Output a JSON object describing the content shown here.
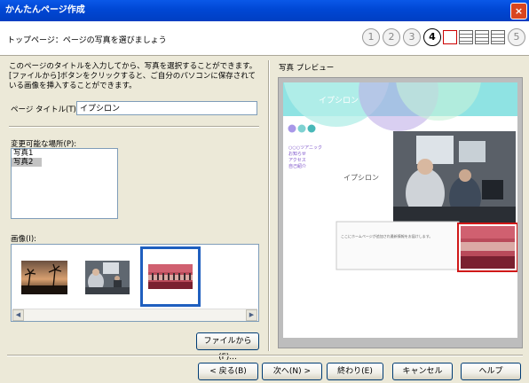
{
  "window": {
    "title": "かんたんページ作成",
    "close_label": "×"
  },
  "header": {
    "title": "トップページ：ページの写真を選びましょう",
    "steps": [
      "1",
      "2",
      "3",
      "4",
      "5"
    ],
    "active_step": "4"
  },
  "description": "このページのタイトルを入力してから、写真を選択することができます。[ファイルから]ボタンをクリックすると、ご自分のパソコンに保存されている画像を挿入することができます。",
  "page_title": {
    "label": "ページ タイトル(T):",
    "value": "イプシロン"
  },
  "changeable": {
    "label": "変更可能な場所(P):",
    "items": [
      "写真1",
      "写真2"
    ],
    "selected": "写真2"
  },
  "images": {
    "label": "画像(I):"
  },
  "file_button": "ファイルから(F)...",
  "preview": {
    "label": "写真 プレビュー",
    "site_title": "イプシロン",
    "body_title": "イプシロン",
    "nav": [
      "○○○ツアニック",
      "お知らせ",
      "アクセス",
      "自己紹介"
    ],
    "notice": "ここにホームページが追加され最新情報をお届けします。"
  },
  "footer": {
    "back": "< 戻る(B)",
    "next": "次へ(N) >",
    "finish": "終わり(E)",
    "cancel": "キャンセル",
    "help": "ヘルプ"
  },
  "colors": {
    "titlebar": "#0a58e8",
    "accent_selection": "#1f5fbf",
    "preview_bg": "#bdbdbd",
    "site_aqua": "#8fe3e3"
  }
}
